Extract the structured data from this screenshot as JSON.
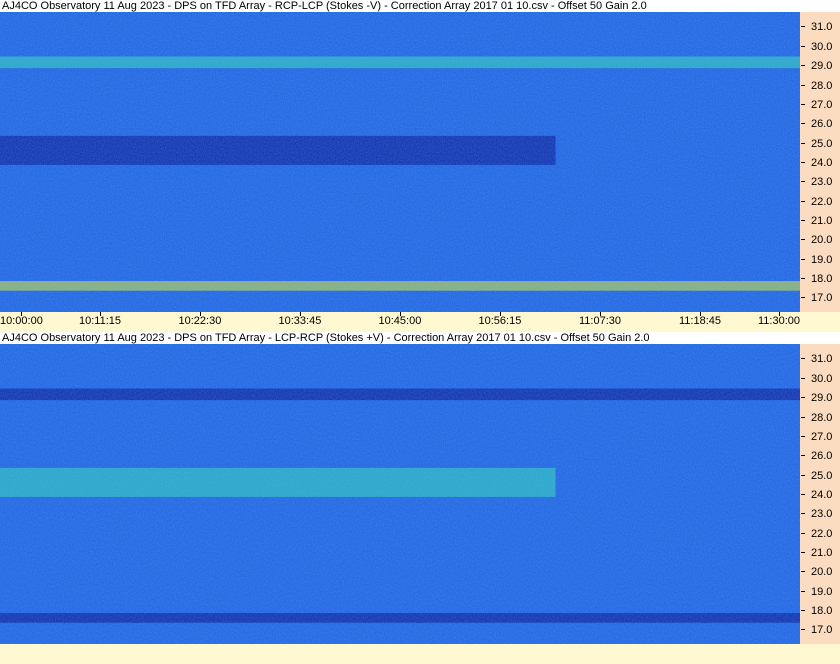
{
  "chart_data": [
    {
      "type": "heatmap",
      "title": "AJ4CO Observatory 11 Aug 2023 -  DPS on TFD Array  -  RCP-LCP (Stokes -V)  -  Correction Array 2017 01 10.csv  -  Offset 50  Gain 2.0",
      "x_ticks": [
        "10:00:00",
        "10:11:15",
        "10:22:30",
        "10:33:45",
        "10:45:00",
        "10:56:15",
        "11:07:30",
        "11:18:45",
        "11:30:00"
      ],
      "y_ticks": [
        "31.0",
        "30.0",
        "29.0",
        "28.0",
        "27.0",
        "26.0",
        "25.0",
        "24.0",
        "23.0",
        "22.0",
        "21.0",
        "20.0",
        "19.0",
        "18.0",
        "17.0"
      ],
      "xlim": [
        "10:00:00",
        "11:30:00"
      ],
      "ylim": [
        16.3,
        31.8
      ],
      "colormap": {
        "low": "#0a1a9a",
        "mid": "#1e60e0",
        "high": "#30e0b0",
        "peak": "#e8f020"
      },
      "bands": [
        {
          "f_min": 23.9,
          "f_max": 25.4,
          "t_end": "11:02:30",
          "level": "dark"
        },
        {
          "f_min": 28.9,
          "f_max": 29.5,
          "level": "bright"
        },
        {
          "f_min": 17.4,
          "f_max": 17.9,
          "level": "bright"
        }
      ]
    },
    {
      "type": "heatmap",
      "title": "AJ4CO Observatory 11 Aug 2023 -  DPS on TFD Array  -  LCP-RCP (Stokes +V)  -  Correction Array 2017 01 10.csv  -  Offset 50  Gain 2.0",
      "x_ticks": [],
      "y_ticks": [
        "31.0",
        "30.0",
        "29.0",
        "28.0",
        "27.0",
        "26.0",
        "25.0",
        "24.0",
        "23.0",
        "22.0",
        "21.0",
        "20.0",
        "19.0",
        "18.0",
        "17.0"
      ],
      "xlim": [
        "10:00:00",
        "11:30:00"
      ],
      "ylim": [
        16.3,
        31.8
      ],
      "colormap": {
        "low": "#0a1a9a",
        "mid": "#1e60e0",
        "high": "#30e0b0",
        "peak": "#e8f020"
      },
      "bands": [
        {
          "f_min": 23.9,
          "f_max": 25.4,
          "t_end": "11:02:30",
          "level": "bright"
        },
        {
          "f_min": 28.9,
          "f_max": 29.5,
          "level": "dark"
        },
        {
          "f_min": 17.4,
          "f_max": 17.9,
          "level": "dark"
        }
      ]
    }
  ]
}
